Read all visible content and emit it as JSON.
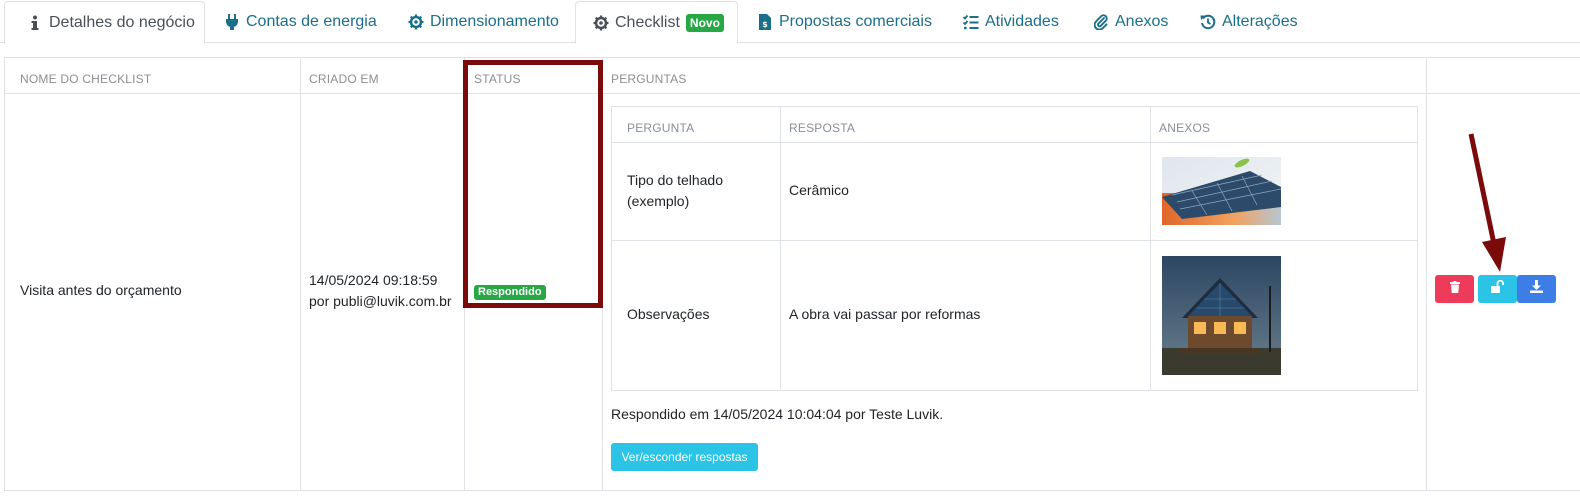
{
  "tabs": [
    {
      "label": "Detalhes do negócio",
      "icon": "info-icon"
    },
    {
      "label": "Contas de energia",
      "icon": "plug-icon"
    },
    {
      "label": "Dimensionamento",
      "icon": "gear-icon"
    },
    {
      "label": "Checklist",
      "icon": "gear-icon",
      "badge": "Novo",
      "active": true
    },
    {
      "label": "Propostas comerciais",
      "icon": "invoice-icon"
    },
    {
      "label": "Atividades",
      "icon": "checklist-icon"
    },
    {
      "label": "Anexos",
      "icon": "paperclip-icon"
    },
    {
      "label": "Alterações",
      "icon": "history-icon"
    }
  ],
  "table": {
    "headers": {
      "name": "NOME DO CHECKLIST",
      "created": "CRIADO EM",
      "status": "STATUS",
      "questions": "PERGUNTAS"
    },
    "row": {
      "name": "Visita antes do orçamento",
      "created_date": "14/05/2024 09:18:59",
      "created_by": "por publi@luvik.com.br",
      "status": "Respondido"
    }
  },
  "questions": {
    "headers": {
      "question": "PERGUNTA",
      "answer": "RESPOSTA",
      "attachments": "ANEXOS"
    },
    "rows": [
      {
        "question_line1": "Tipo do telhado",
        "question_line2": "(exemplo)",
        "answer": "Cerâmico",
        "attachment": "solar-panel-photo"
      },
      {
        "question_line1": "Observações",
        "question_line2": "",
        "answer": "A obra vai passar por reformas",
        "attachment": "house-photo"
      }
    ],
    "answered_line": "Respondido em 14/05/2024 10:04:04 por Teste Luvik.",
    "toggle_label": "Ver/esconder respostas"
  },
  "actions": [
    {
      "icon": "trash-icon",
      "color": "#ee3b5b"
    },
    {
      "icon": "unlock-icon",
      "color": "#2bc3e6"
    },
    {
      "icon": "download-icon",
      "color": "#3c7de6"
    }
  ],
  "colors": {
    "link": "#1a6f8a",
    "success": "#28a745",
    "annotation": "#7b0a0a"
  }
}
